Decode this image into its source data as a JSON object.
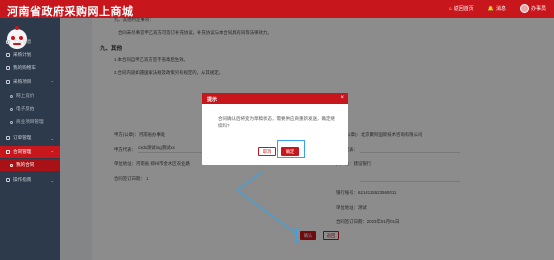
{
  "header": {
    "logo": "河南省政府采购网上商城",
    "system_link": "返回首页",
    "notifications": "消息",
    "username": "办事员"
  },
  "sidebar": {
    "items": [
      {
        "label": "个人信息"
      },
      {
        "label": "采购计划"
      },
      {
        "label": "我的购物车"
      },
      {
        "label": "采购项目"
      },
      {
        "label": "网上竞价"
      },
      {
        "label": "电子反拍"
      },
      {
        "label": "商业项目管理"
      },
      {
        "label": "订单管理"
      },
      {
        "label": "合同管理"
      },
      {
        "label": "我的合同"
      },
      {
        "label": "操作指南"
      }
    ]
  },
  "contract": {
    "line_top": "九、其他约定事项：",
    "para1": "合同未尽事宜甲乙双方可签订补充协议，补充协议与本合同具有同等法律效力。",
    "section9": "九、其他",
    "item1": "1.本合同自甲乙双方签字盖章后生效。",
    "item2": "2.合同内容如遇国家法规及政策另有规定的，从其规定。",
    "buyer_label": "甲方(公章)：河南省办事处",
    "seller_label": "乙方(公章)：北京聚阿国际技术咨询有限公司",
    "buyer_rep": "甲方代表：",
    "buyer_rep_val": "cxdx测试ing测试xx",
    "seller_rep": "乙方代表：",
    "buyer_addr": "单位地址：河南省 郑州市金水区农业路",
    "seller_bank": "开户行：建设银行",
    "buyer_date": "合同签订日期： 1",
    "seller_acct": "银行账号：6214115523560011",
    "seller_addr": "单位地址：测试",
    "seller_date": "合同签订日期：2023年01月01日"
  },
  "dialog": {
    "title": "提示",
    "close": "×",
    "message": "合同确认后将变为草稿状态，需要供应商重新发送，确定继续吗?",
    "cancel_label": "取消",
    "ok_label": "确定"
  },
  "footer_buttons": {
    "submit_label": "确认",
    "back_label": "返回"
  },
  "colors": {
    "brand": "#c8161d",
    "sidebar": "#2d3a4b",
    "highlight": "#3aa3e3"
  }
}
